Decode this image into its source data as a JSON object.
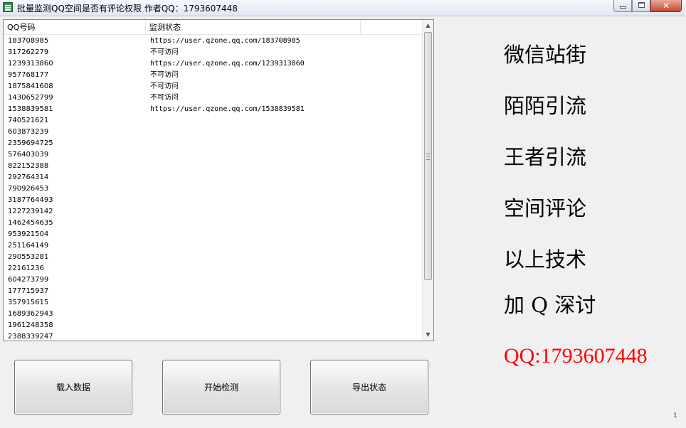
{
  "window": {
    "title": "批量监测QQ空间是否有评论权限  作者QQ：1793607448",
    "close_glyph": "✕"
  },
  "table": {
    "columns": [
      "QQ号码",
      "监测状态"
    ],
    "rows": [
      {
        "qq": "183708985",
        "status": "https://user.qzone.qq.com/183708985"
      },
      {
        "qq": "317262279",
        "status": "不可访问"
      },
      {
        "qq": "1239313860",
        "status": "https://user.qzone.qq.com/1239313860"
      },
      {
        "qq": "957768177",
        "status": "不可访问"
      },
      {
        "qq": "1875841608",
        "status": "不可访问"
      },
      {
        "qq": "1430652799",
        "status": "不可访问"
      },
      {
        "qq": "1538839581",
        "status": "https://user.qzone.qq.com/1538839581"
      },
      {
        "qq": "740521621",
        "status": ""
      },
      {
        "qq": "603873239",
        "status": ""
      },
      {
        "qq": "2359694725",
        "status": ""
      },
      {
        "qq": "576403039",
        "status": ""
      },
      {
        "qq": "822152388",
        "status": ""
      },
      {
        "qq": "292764314",
        "status": ""
      },
      {
        "qq": "790926453",
        "status": ""
      },
      {
        "qq": "3187764493",
        "status": ""
      },
      {
        "qq": "1227239142",
        "status": ""
      },
      {
        "qq": "1462454635",
        "status": ""
      },
      {
        "qq": "953921504",
        "status": ""
      },
      {
        "qq": "251164149",
        "status": ""
      },
      {
        "qq": "290553281",
        "status": ""
      },
      {
        "qq": "22161236",
        "status": ""
      },
      {
        "qq": "604273799",
        "status": ""
      },
      {
        "qq": "177715937",
        "status": ""
      },
      {
        "qq": "357915615",
        "status": ""
      },
      {
        "qq": "1689362943",
        "status": ""
      },
      {
        "qq": "1961248358",
        "status": ""
      },
      {
        "qq": "2388339247",
        "status": ""
      }
    ]
  },
  "buttons": {
    "load": "载入数据",
    "start": "开始检测",
    "export": "导出状态"
  },
  "promo": {
    "lines": [
      "微信站街",
      "陌陌引流",
      "王者引流",
      "空间评论",
      "以上技术",
      "加 Q 深讨"
    ],
    "qq": "QQ:1793607448",
    "qq_color": "#ff0000"
  },
  "corner_mark": "1"
}
